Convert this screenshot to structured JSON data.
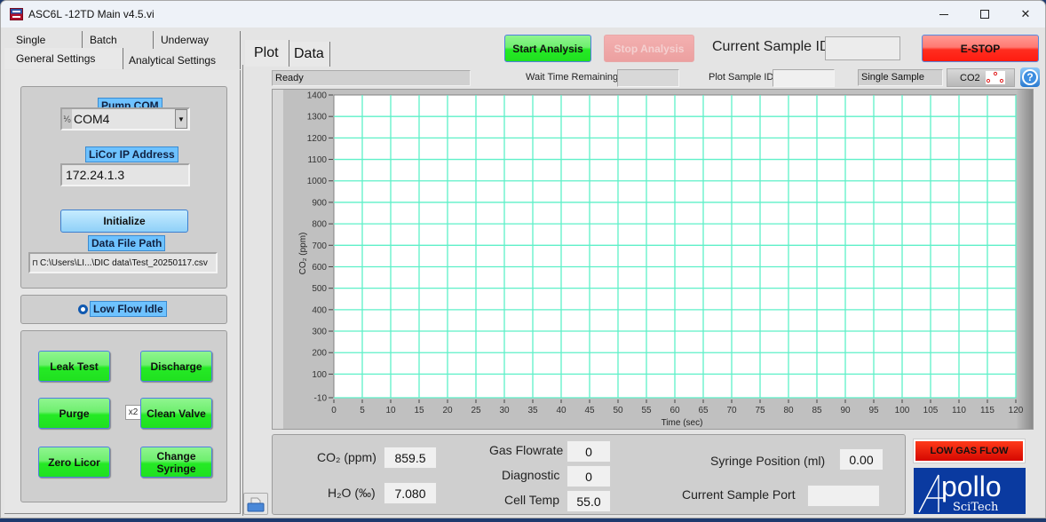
{
  "window": {
    "title": "ASC6L -12TD Main v4.5.vi",
    "controls": [
      "minimize",
      "maximize",
      "close"
    ]
  },
  "left_tabs": {
    "row1": [
      "Single",
      "Batch",
      "Underway"
    ],
    "row2": [
      "General Settings",
      "Analytical Settings"
    ],
    "active": "General Settings"
  },
  "connection": {
    "pump_com_label": "Pump COM",
    "pump_com_value": "COM4",
    "io_glyph": "I/O",
    "licor_ip_label": "LiCor IP Address",
    "licor_ip_value": "172.24.1.3",
    "initialize_label": "Initialize",
    "data_file_path_label": "Data File Path",
    "data_file_path_value": "C:\\Users\\LI...\\DIC data\\Test_20250117.csv",
    "path_glyph": "⎕"
  },
  "idle": {
    "label": "Low Flow Idle",
    "selected": true
  },
  "actions": {
    "leak_test": "Leak Test",
    "discharge": "Discharge",
    "purge": "Purge",
    "x2": "x2",
    "clean_valve": "Clean Valve",
    "zero_licor": "Zero Licor",
    "change_syringe_line1": "Change",
    "change_syringe_line2": "Syringe"
  },
  "right_tabs": {
    "items": [
      "Plot",
      "Data"
    ],
    "active": "Plot"
  },
  "toolbar": {
    "start_analysis": "Start Analysis",
    "stop_analysis": "Stop Analysis",
    "current_sample_id_label": "Current Sample ID",
    "current_sample_id_value": "",
    "estop": "E-STOP"
  },
  "status": {
    "text": "Ready",
    "wait_time_label": "Wait Time Remaining",
    "wait_time_value": "",
    "plot_sample_id_label": "Plot Sample ID",
    "plot_sample_id_value": "",
    "sample_mode": "Single Sample",
    "legend_label": "CO2"
  },
  "chart_data": {
    "type": "line",
    "title": "",
    "xlabel": "Time (sec)",
    "ylabel": "CO₂ (ppm)",
    "xlim": [
      0,
      120
    ],
    "ylim": [
      -10,
      1400
    ],
    "x_ticks": [
      0,
      5,
      10,
      15,
      20,
      25,
      30,
      35,
      40,
      45,
      50,
      55,
      60,
      65,
      70,
      75,
      80,
      85,
      90,
      95,
      100,
      105,
      110,
      115,
      120
    ],
    "y_ticks": [
      -10,
      100,
      200,
      300,
      400,
      500,
      600,
      700,
      800,
      900,
      1000,
      1100,
      1200,
      1300,
      1400
    ],
    "grid": true,
    "grid_color": "#5ef0c8",
    "series": [
      {
        "name": "CO2",
        "color": "#e02020",
        "x": [],
        "y": []
      }
    ]
  },
  "readouts": {
    "co2_label": "CO₂ (ppm)",
    "co2_value": "859.5",
    "h2o_label": "H₂O (‰)",
    "h2o_value": "7.080",
    "gas_flowrate_label": "Gas Flowrate",
    "gas_flowrate_value": "0",
    "diagnostic_label": "Diagnostic",
    "diagnostic_value": "0",
    "cell_temp_label": "Cell Temp",
    "cell_temp_value": "55.0",
    "syringe_position_label": "Syringe Position (ml)",
    "syringe_position_value": "0.00",
    "current_sample_port_label": "Current Sample Port",
    "current_sample_port_value": ""
  },
  "alarm": {
    "low_gas_flow": "LOW GAS FLOW",
    "color": "#e81a0a"
  },
  "logo": {
    "line1": "pollo",
    "initial": "A",
    "line2": "SciTech",
    "bg_color": "#0a3aa0"
  }
}
